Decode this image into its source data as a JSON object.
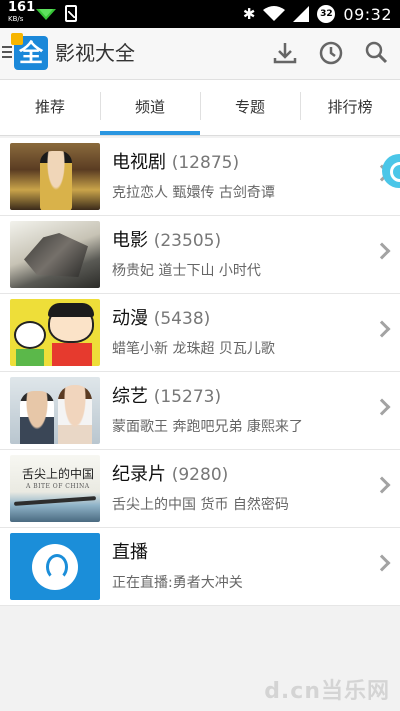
{
  "status_bar": {
    "net_speed": "161",
    "net_unit": "KB/s",
    "battery_level": "32",
    "time": "09:32",
    "icons": [
      "wifi-download-icon",
      "file-icon",
      "bluetooth-icon",
      "wifi-icon",
      "signal-icon",
      "battery-icon"
    ]
  },
  "header": {
    "logo_text": "全",
    "title": "影视大全",
    "icons": [
      "menu-icon",
      "download-icon",
      "history-icon",
      "search-icon"
    ]
  },
  "tabs": [
    {
      "label": "推荐",
      "active": false
    },
    {
      "label": "频道",
      "active": true
    },
    {
      "label": "专题",
      "active": false
    },
    {
      "label": "排行榜",
      "active": false
    }
  ],
  "channels": [
    {
      "title": "电视剧",
      "count": "(12875)",
      "subtitle": "克拉恋人 甄嬛传 古剑奇谭"
    },
    {
      "title": "电影",
      "count": "(23505)",
      "subtitle": "杨贵妃 道士下山 小时代"
    },
    {
      "title": "动漫",
      "count": "(5438)",
      "subtitle": "蜡笔小新 龙珠超 贝瓦儿歌"
    },
    {
      "title": "综艺",
      "count": "(15273)",
      "subtitle": "蒙面歌王 奔跑吧兄弟 康熙来了"
    },
    {
      "title": "纪录片",
      "count": "(9280)",
      "subtitle": "舌尖上的中国 货币 自然密码"
    },
    {
      "title": "直播",
      "count": "",
      "subtitle": "正在直播:勇者大冲关"
    }
  ],
  "thumb_text": {
    "doc_title": "舌尖上的中国",
    "doc_sub": "A BITE OF CHINA"
  },
  "watermark": "d.cn当乐网",
  "colors": {
    "accent": "#2a96e0",
    "logo": "#1b88d9"
  }
}
